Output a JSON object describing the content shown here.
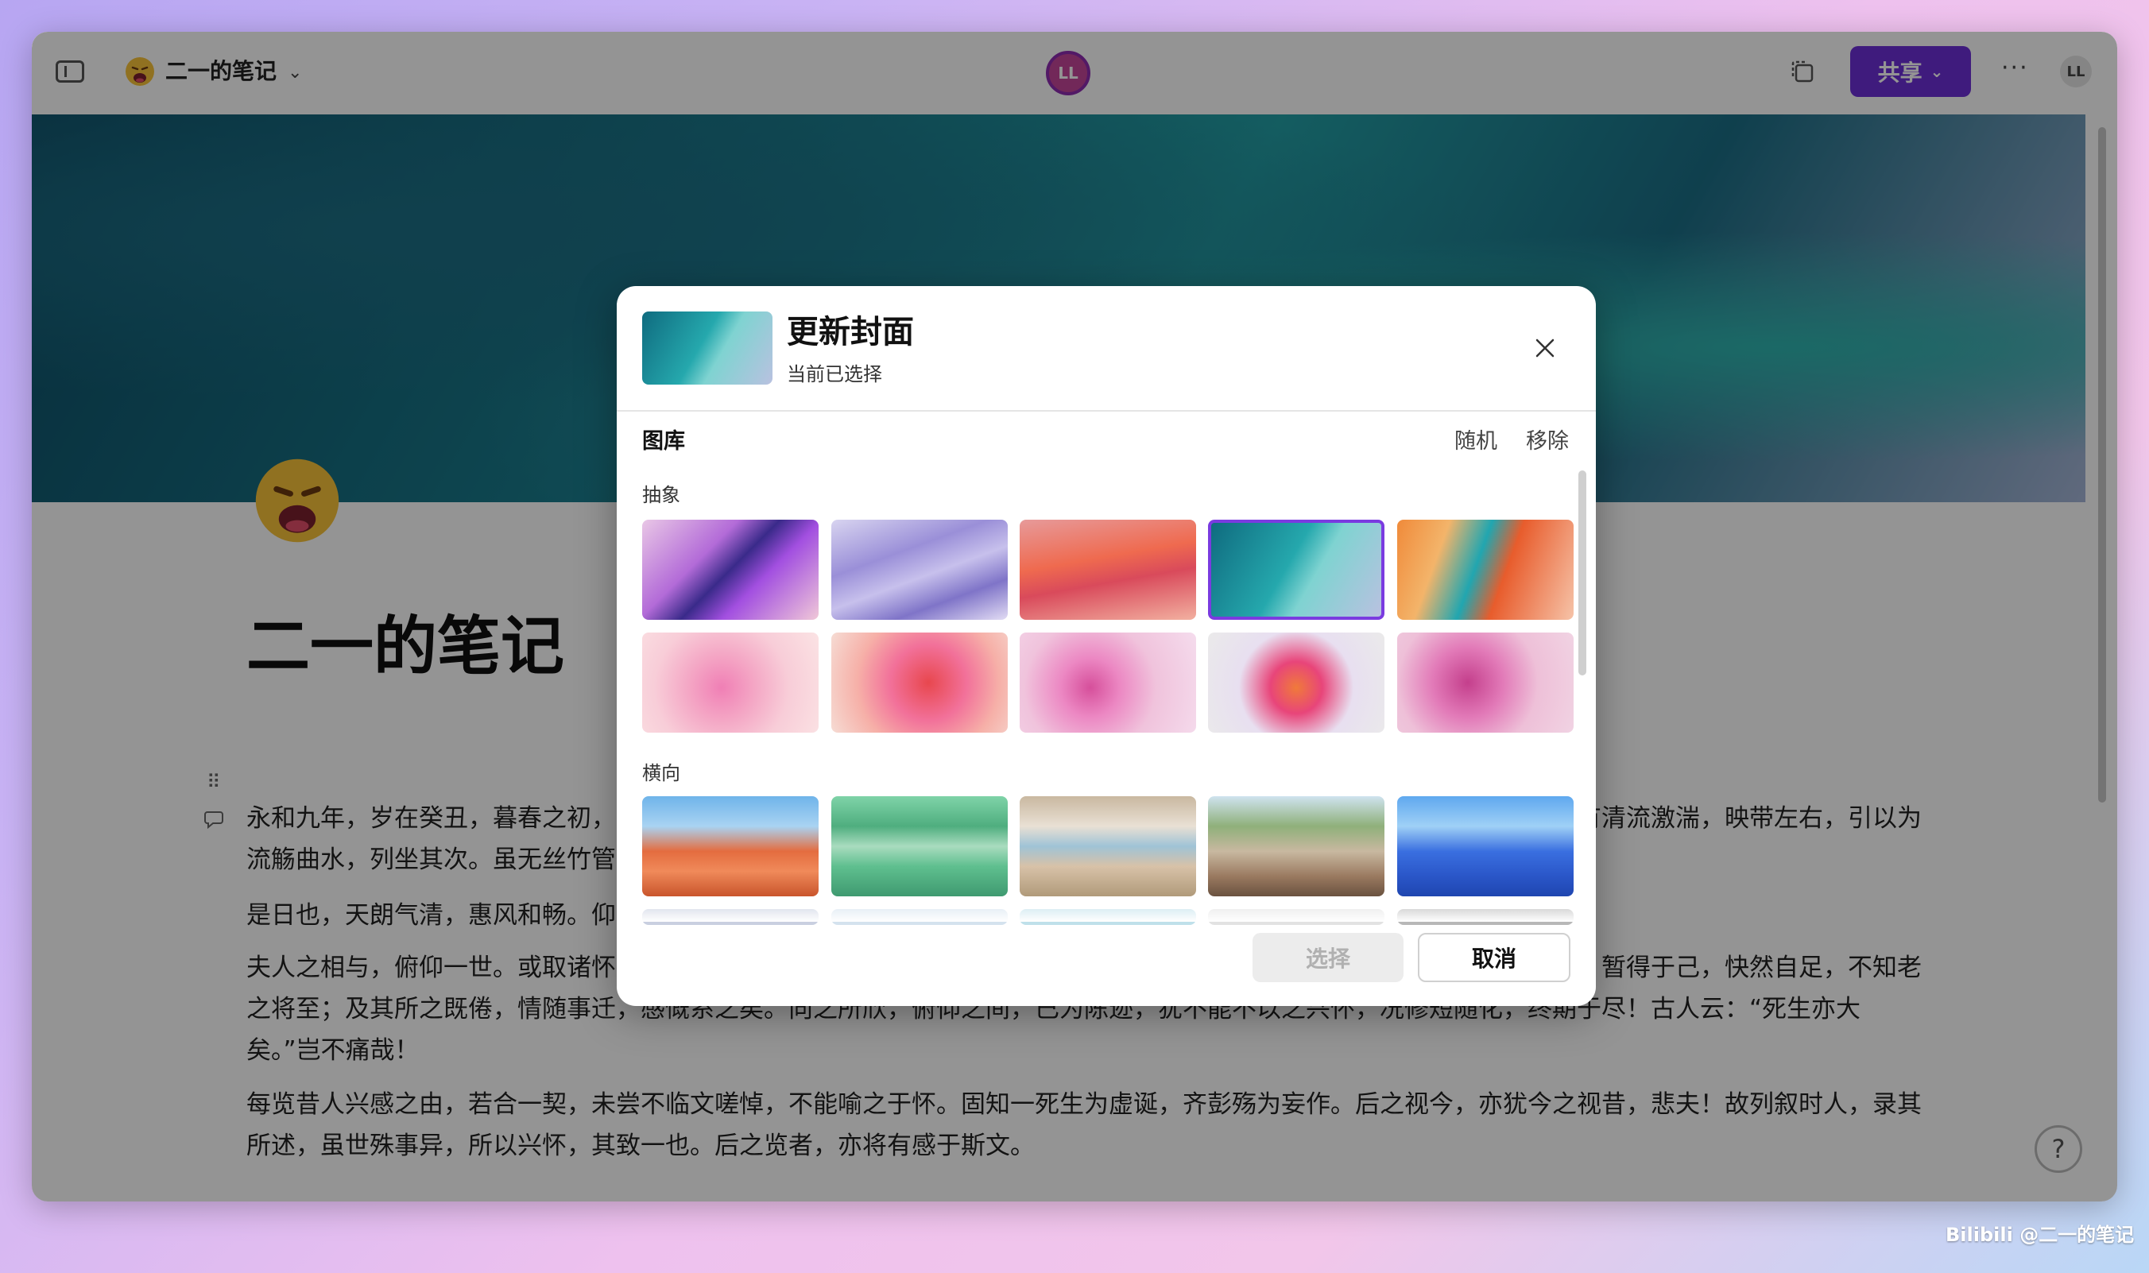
{
  "titlebar": {
    "doc_title": "二一的笔记",
    "center_avatar": "LL",
    "share_label": "共享",
    "more_label": "···",
    "user_avatar": "LL"
  },
  "document": {
    "title": "二一的笔记",
    "paragraphs": [
      "永和九年，岁在癸丑，暮春之初，会于会稽山阴之兰亭，修禊事也。群贤毕至，少长咸集。此地有崇山峻岭，茂林修竹，又有清流激湍，映带左右，引以为流觞曲水，列坐其次。虽无丝竹管弦之盛，一觞一咏，亦足以畅叙幽情。",
      "是日也，天朗气清，惠风和畅。仰观宇宙之大，俯察品类之盛，所以游目骋怀，足以极视听之娱，信可乐也。",
      "夫人之相与，俯仰一世。或取诸怀抱，悟言一室之内；或因寄所托，放浪形骸之外。虽趣舍万殊，静躁不同，当其欣于所遇，暂得于己，快然自足，不知老之将至；及其所之既倦，情随事迁，感慨系之矣。向之所欣，俯仰之间，已为陈迹，犹不能不以之兴怀，况修短随化，终期于尽！古人云：“死生亦大矣。”岂不痛哉！",
      "每览昔人兴感之由，若合一契，未尝不临文嗟悼，不能喻之于怀。固知一死生为虚诞，齐彭殇为妄作。后之视今，亦犹今之视昔，悲夫！故列叙时人，录其所述，虽世殊事异，所以兴怀，其致一也。后之览者，亦将有感于斯文。"
    ]
  },
  "help_label": "?",
  "watermark": "Bilibili @二一的笔记",
  "dialog": {
    "title": "更新封面",
    "subtitle": "当前已选择",
    "gallery_title": "图库",
    "random_label": "随机",
    "remove_label": "移除",
    "sections": [
      "抽象",
      "横向"
    ],
    "select_label": "选择",
    "cancel_label": "取消",
    "colors": {
      "accent": "#7a3be0",
      "share": "#6d2fd8"
    }
  }
}
